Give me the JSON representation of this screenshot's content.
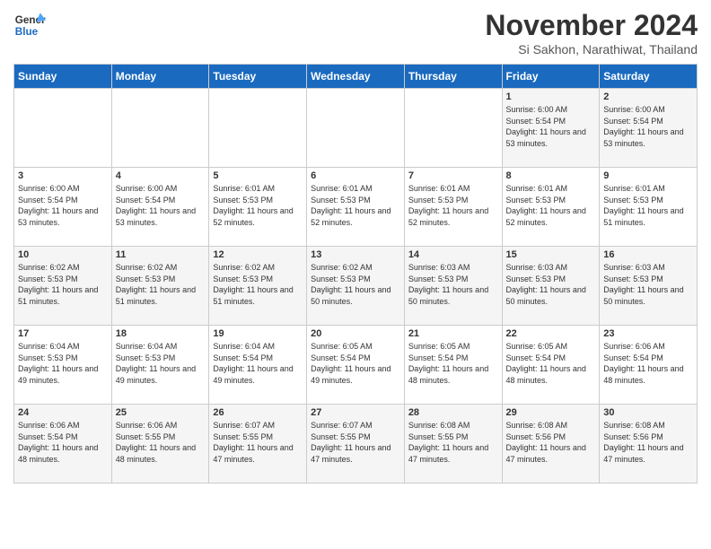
{
  "header": {
    "logo_general": "General",
    "logo_blue": "Blue",
    "month_title": "November 2024",
    "subtitle": "Si Sakhon, Narathiwat, Thailand"
  },
  "weekdays": [
    "Sunday",
    "Monday",
    "Tuesday",
    "Wednesday",
    "Thursday",
    "Friday",
    "Saturday"
  ],
  "weeks": [
    [
      {
        "day": "",
        "info": ""
      },
      {
        "day": "",
        "info": ""
      },
      {
        "day": "",
        "info": ""
      },
      {
        "day": "",
        "info": ""
      },
      {
        "day": "",
        "info": ""
      },
      {
        "day": "1",
        "info": "Sunrise: 6:00 AM\nSunset: 5:54 PM\nDaylight: 11 hours and 53 minutes."
      },
      {
        "day": "2",
        "info": "Sunrise: 6:00 AM\nSunset: 5:54 PM\nDaylight: 11 hours and 53 minutes."
      }
    ],
    [
      {
        "day": "3",
        "info": "Sunrise: 6:00 AM\nSunset: 5:54 PM\nDaylight: 11 hours and 53 minutes."
      },
      {
        "day": "4",
        "info": "Sunrise: 6:00 AM\nSunset: 5:54 PM\nDaylight: 11 hours and 53 minutes."
      },
      {
        "day": "5",
        "info": "Sunrise: 6:01 AM\nSunset: 5:53 PM\nDaylight: 11 hours and 52 minutes."
      },
      {
        "day": "6",
        "info": "Sunrise: 6:01 AM\nSunset: 5:53 PM\nDaylight: 11 hours and 52 minutes."
      },
      {
        "day": "7",
        "info": "Sunrise: 6:01 AM\nSunset: 5:53 PM\nDaylight: 11 hours and 52 minutes."
      },
      {
        "day": "8",
        "info": "Sunrise: 6:01 AM\nSunset: 5:53 PM\nDaylight: 11 hours and 52 minutes."
      },
      {
        "day": "9",
        "info": "Sunrise: 6:01 AM\nSunset: 5:53 PM\nDaylight: 11 hours and 51 minutes."
      }
    ],
    [
      {
        "day": "10",
        "info": "Sunrise: 6:02 AM\nSunset: 5:53 PM\nDaylight: 11 hours and 51 minutes."
      },
      {
        "day": "11",
        "info": "Sunrise: 6:02 AM\nSunset: 5:53 PM\nDaylight: 11 hours and 51 minutes."
      },
      {
        "day": "12",
        "info": "Sunrise: 6:02 AM\nSunset: 5:53 PM\nDaylight: 11 hours and 51 minutes."
      },
      {
        "day": "13",
        "info": "Sunrise: 6:02 AM\nSunset: 5:53 PM\nDaylight: 11 hours and 50 minutes."
      },
      {
        "day": "14",
        "info": "Sunrise: 6:03 AM\nSunset: 5:53 PM\nDaylight: 11 hours and 50 minutes."
      },
      {
        "day": "15",
        "info": "Sunrise: 6:03 AM\nSunset: 5:53 PM\nDaylight: 11 hours and 50 minutes."
      },
      {
        "day": "16",
        "info": "Sunrise: 6:03 AM\nSunset: 5:53 PM\nDaylight: 11 hours and 50 minutes."
      }
    ],
    [
      {
        "day": "17",
        "info": "Sunrise: 6:04 AM\nSunset: 5:53 PM\nDaylight: 11 hours and 49 minutes."
      },
      {
        "day": "18",
        "info": "Sunrise: 6:04 AM\nSunset: 5:53 PM\nDaylight: 11 hours and 49 minutes."
      },
      {
        "day": "19",
        "info": "Sunrise: 6:04 AM\nSunset: 5:54 PM\nDaylight: 11 hours and 49 minutes."
      },
      {
        "day": "20",
        "info": "Sunrise: 6:05 AM\nSunset: 5:54 PM\nDaylight: 11 hours and 49 minutes."
      },
      {
        "day": "21",
        "info": "Sunrise: 6:05 AM\nSunset: 5:54 PM\nDaylight: 11 hours and 48 minutes."
      },
      {
        "day": "22",
        "info": "Sunrise: 6:05 AM\nSunset: 5:54 PM\nDaylight: 11 hours and 48 minutes."
      },
      {
        "day": "23",
        "info": "Sunrise: 6:06 AM\nSunset: 5:54 PM\nDaylight: 11 hours and 48 minutes."
      }
    ],
    [
      {
        "day": "24",
        "info": "Sunrise: 6:06 AM\nSunset: 5:54 PM\nDaylight: 11 hours and 48 minutes."
      },
      {
        "day": "25",
        "info": "Sunrise: 6:06 AM\nSunset: 5:55 PM\nDaylight: 11 hours and 48 minutes."
      },
      {
        "day": "26",
        "info": "Sunrise: 6:07 AM\nSunset: 5:55 PM\nDaylight: 11 hours and 47 minutes."
      },
      {
        "day": "27",
        "info": "Sunrise: 6:07 AM\nSunset: 5:55 PM\nDaylight: 11 hours and 47 minutes."
      },
      {
        "day": "28",
        "info": "Sunrise: 6:08 AM\nSunset: 5:55 PM\nDaylight: 11 hours and 47 minutes."
      },
      {
        "day": "29",
        "info": "Sunrise: 6:08 AM\nSunset: 5:56 PM\nDaylight: 11 hours and 47 minutes."
      },
      {
        "day": "30",
        "info": "Sunrise: 6:08 AM\nSunset: 5:56 PM\nDaylight: 11 hours and 47 minutes."
      }
    ]
  ]
}
